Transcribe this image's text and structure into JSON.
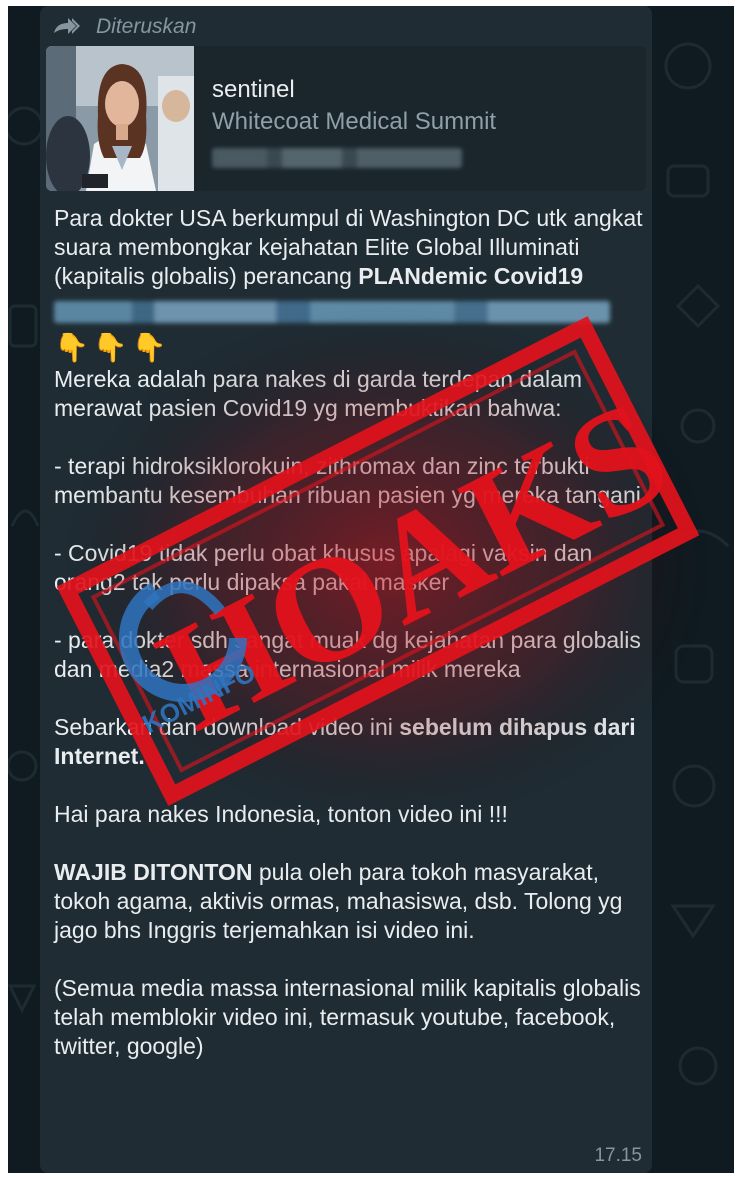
{
  "chat": {
    "forwarded_label": "Diteruskan",
    "time": "17.15"
  },
  "link_preview": {
    "title": "sentinel",
    "subtitle": "Whitecoat Medical Summit"
  },
  "message": {
    "intro": "Para dokter USA berkumpul di Washington DC utk angkat suara membongkar kejahatan Elite Global Illuminati (kapitalis globalis) perancang ",
    "intro_bold": "PLANdemic Covid19",
    "emoji": "👇👇👇",
    "p1": "Mereka adalah para nakes di garda terdepan dalam merawat pasien Covid19 yg membuktikan bahwa:",
    "p2": "- terapi hidroksiklorokuin, zithromax dan zinc terbukti membantu kesembuhan ribuan pasien yg mereka tangani",
    "p3": "- Covid19 tidak perlu obat khusus apalagi vaksin dan orang2 tak perlu dipaksa pakai masker",
    "p4": "- para dokter sdh sangat muak dg kejahatan para globalis dan media2 massa internasional milik mereka",
    "p5": "Sebarkan dan download video ini ",
    "p5_bold": "sebelum dihapus dari Internet.",
    "p6": "Hai para nakes Indonesia, tonton video ini !!!",
    "p7_bold": "WAJIB DITONTON",
    "p7": " pula oleh para tokoh masyarakat, tokoh agama, aktivis ormas, mahasiswa, dsb. Tolong yg jago bhs Inggris terjemahkan isi video ini.",
    "p8": "(Semua media massa internasional milik kapitalis globalis telah memblokir video ini, termasuk youtube, facebook, twitter, google)"
  },
  "stamp": {
    "text": "HOAKS",
    "logo_text": "KOMINFO",
    "color": "#e3121c"
  }
}
